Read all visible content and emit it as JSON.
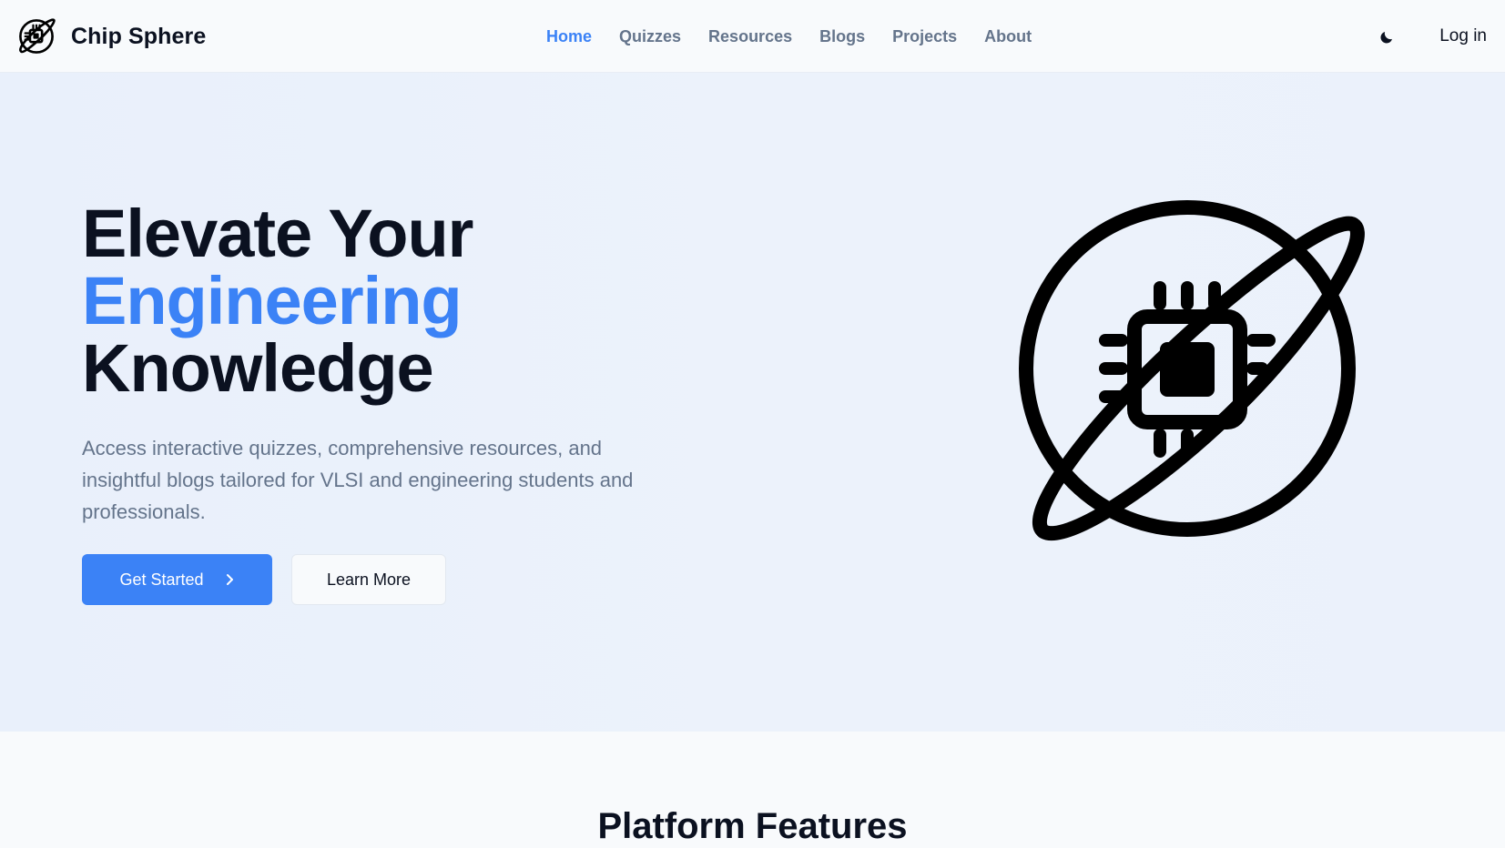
{
  "brand": {
    "name": "Chip Sphere"
  },
  "nav": {
    "items": [
      {
        "label": "Home",
        "active": true
      },
      {
        "label": "Quizzes",
        "active": false
      },
      {
        "label": "Resources",
        "active": false
      },
      {
        "label": "Blogs",
        "active": false
      },
      {
        "label": "Projects",
        "active": false
      },
      {
        "label": "About",
        "active": false
      }
    ],
    "theme_icon": "moon-icon",
    "login_label": "Log in"
  },
  "hero": {
    "title_line1": "Elevate Your",
    "title_line2": "Engineering",
    "title_line3": "Knowledge",
    "description": "Access interactive quizzes, comprehensive resources, and insightful blogs tailored for VLSI and engineering students and professionals.",
    "primary_button": "Get Started",
    "secondary_button": "Learn More",
    "illustration_icon": "chip-sphere-logo-icon"
  },
  "features": {
    "title": "Platform Features"
  },
  "colors": {
    "accent": "#3b82f6",
    "text": "#0b1120",
    "muted": "#64748b",
    "hero_bg": "#eaf0fb"
  }
}
